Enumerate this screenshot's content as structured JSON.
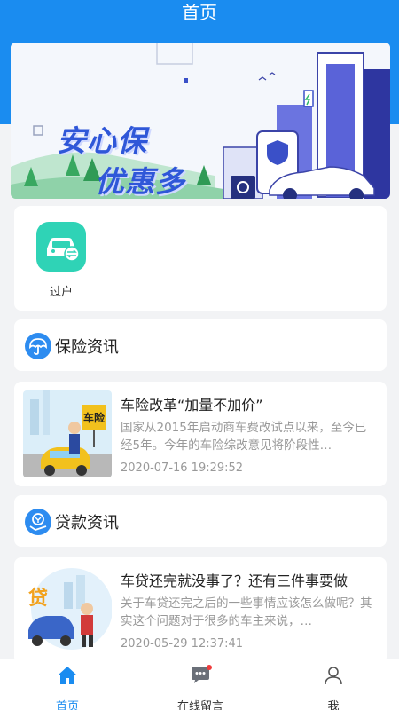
{
  "header": {
    "title": "首页"
  },
  "banner": {
    "line1": "安心保",
    "line2": "优惠多"
  },
  "quick_actions": [
    {
      "label": "过户",
      "icon": "car-transfer-icon"
    }
  ],
  "sections": [
    {
      "title": "保险资讯",
      "icon": "umbrella-icon",
      "news": {
        "thumb_text": "车险",
        "title": "车险改革“加量不加价”",
        "summary": "国家从2015年启动商车费改试点以来，至今已经5年。今年的车险综改意见将阶段性…",
        "date": "2020-07-16 19:29:52"
      }
    },
    {
      "title": "贷款资讯",
      "icon": "loan-icon",
      "news": {
        "thumb_text": "贷",
        "title": "车贷还完就没事了？还有三件事要做",
        "summary": "关于车贷还完之后的一些事情应该怎么做呢？其实这个问题对于很多的车主来说，…",
        "date": "2020-05-29 12:37:41"
      }
    }
  ],
  "tabbar": {
    "items": [
      {
        "label": "首页",
        "icon": "home-icon",
        "active": true
      },
      {
        "label": "在线留言",
        "icon": "chat-icon",
        "active": false,
        "badge": true
      },
      {
        "label": "我",
        "icon": "user-icon",
        "active": false
      }
    ]
  },
  "colors": {
    "primary": "#1a8cf0",
    "teal": "#2fd3b6",
    "badge": "#f03c3c"
  }
}
